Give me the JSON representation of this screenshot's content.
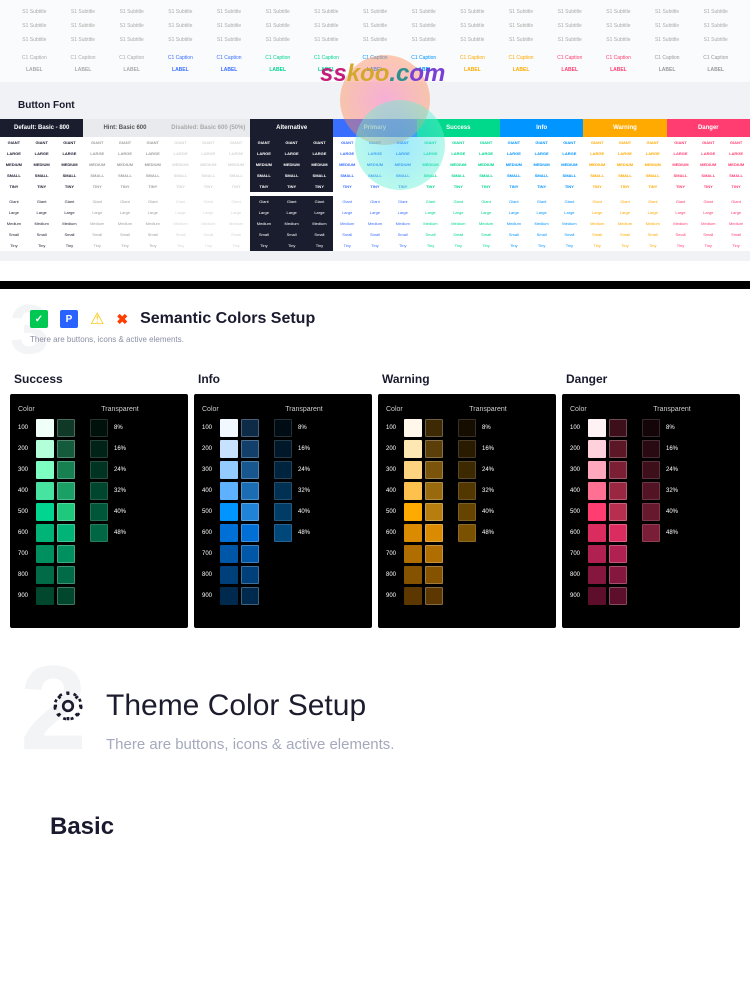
{
  "topRows": {
    "labels_row": [
      "S1 Subtitle",
      "S1 Subtitle",
      "S1 Subtitle",
      "S1 Subtitle",
      "S1 Subtitle",
      "S1 Subtitle",
      "S1 Subtitle",
      "S1 Subtitle",
      "S1 Subtitle",
      "S1 Subtitle",
      "S1 Subtitle",
      "S1 Subtitle",
      "S1 Subtitle",
      "S1 Subtitle",
      "S1 Subtitle"
    ],
    "caption_row": [
      "C1 Caption",
      "C1 Caption",
      "C1 Caption",
      "C1 Caption",
      "C1 Caption",
      "C1 Caption",
      "C1 Caption",
      "C1 Caption",
      "C1 Caption",
      "C1 Caption",
      "C1 Caption",
      "C1 Caption",
      "C1 Caption",
      "C1 Caption",
      "C1 Caption"
    ],
    "label_row": [
      "LABEL",
      "LABEL",
      "LABEL",
      "LABEL",
      "LABEL",
      "LABEL",
      "LABEL",
      "LABEL",
      "LABEL",
      "LABEL",
      "LABEL",
      "LABEL",
      "LABEL",
      "LABEL",
      "LABEL"
    ]
  },
  "topColors": [
    "#aaa",
    "#aaa",
    "#aaa",
    "#3a6eff",
    "#3a6eff",
    "#00d68f",
    "#00d68f",
    "#0095ff",
    "#0095ff",
    "#ffaa00",
    "#ffaa00",
    "#ff3d71",
    "#ff3d71",
    "#999",
    "#999"
  ],
  "buttonFont": {
    "title": "Button Font",
    "headers": [
      "Default: Basic - 800",
      "Hint: Basic 600",
      "Disabled: Basic 600 (50%)",
      "Alternative",
      "Primary",
      "Success",
      "Info",
      "Warning",
      "Danger"
    ],
    "sizes_upper": [
      "GIANT",
      "LARGE",
      "MEDIUM",
      "SMALL",
      "TINY"
    ],
    "sizes_title": [
      "Giant",
      "Large",
      "Medium",
      "Small",
      "Tiny"
    ],
    "groupColors": {
      "default": "#1a1a2e",
      "hint": "#a0a0a0",
      "disabled": "#d5d5d5",
      "alternative": "#ffffff",
      "primary": "#3a6eff",
      "success": "#00d68f",
      "info": "#0095ff",
      "warning": "#ffaa00",
      "danger": "#ff3d71"
    }
  },
  "semantic": {
    "title": "Semantic Colors Setup",
    "subtitle": "There are buttons, icons & active elements.",
    "bgNum": "3"
  },
  "palettes": [
    {
      "title": "Success",
      "colorHdr": "Color",
      "transHdr": "Transparent",
      "shades": [
        {
          "num": "100",
          "c": "#f0fff7",
          "o": "#103826"
        },
        {
          "num": "200",
          "c": "#b3ffd9",
          "o": "#135b3a"
        },
        {
          "num": "300",
          "c": "#7dffc2",
          "o": "#178050"
        },
        {
          "num": "400",
          "c": "#47e3a0",
          "o": "#1aa065"
        },
        {
          "num": "500",
          "c": "#00d68f",
          "o": "#1ec97e"
        },
        {
          "num": "600",
          "c": "#00b377",
          "o": "#00b377"
        },
        {
          "num": "700",
          "c": "#008f5e",
          "o": "#008f5e"
        },
        {
          "num": "800",
          "c": "#006b46",
          "o": "#006b46"
        },
        {
          "num": "900",
          "c": "#00472e",
          "o": "#00472e"
        }
      ],
      "trans": [
        {
          "p": "8%",
          "c": "rgba(0,214,143,0.08)"
        },
        {
          "p": "16%",
          "c": "rgba(0,214,143,0.16)"
        },
        {
          "p": "24%",
          "c": "rgba(0,214,143,0.24)"
        },
        {
          "p": "32%",
          "c": "rgba(0,214,143,0.32)"
        },
        {
          "p": "40%",
          "c": "rgba(0,214,143,0.40)"
        },
        {
          "p": "48%",
          "c": "rgba(0,214,143,0.48)"
        }
      ]
    },
    {
      "title": "Info",
      "colorHdr": "Color",
      "transHdr": "Transparent",
      "shades": [
        {
          "num": "100",
          "c": "#f2f8ff",
          "o": "#0d2a47"
        },
        {
          "num": "200",
          "c": "#c7e2ff",
          "o": "#12406b"
        },
        {
          "num": "300",
          "c": "#94cbff",
          "o": "#17568f"
        },
        {
          "num": "400",
          "c": "#5eb1ff",
          "o": "#1b6db3"
        },
        {
          "num": "500",
          "c": "#0095ff",
          "o": "#2083d7"
        },
        {
          "num": "600",
          "c": "#006fd6",
          "o": "#006fd6"
        },
        {
          "num": "700",
          "c": "#0057a8",
          "o": "#0057a8"
        },
        {
          "num": "800",
          "c": "#00407a",
          "o": "#00407a"
        },
        {
          "num": "900",
          "c": "#002a4d",
          "o": "#002a4d"
        }
      ],
      "trans": [
        {
          "p": "8%",
          "c": "rgba(0,149,255,0.08)"
        },
        {
          "p": "16%",
          "c": "rgba(0,149,255,0.16)"
        },
        {
          "p": "24%",
          "c": "rgba(0,149,255,0.24)"
        },
        {
          "p": "32%",
          "c": "rgba(0,149,255,0.32)"
        },
        {
          "p": "40%",
          "c": "rgba(0,149,255,0.40)"
        },
        {
          "p": "48%",
          "c": "rgba(0,149,255,0.48)"
        }
      ]
    },
    {
      "title": "Warning",
      "colorHdr": "Color",
      "transHdr": "Transparent",
      "shades": [
        {
          "num": "100",
          "c": "#fff8eb",
          "o": "#3d2a05"
        },
        {
          "num": "200",
          "c": "#ffe7b3",
          "o": "#5c3f08"
        },
        {
          "num": "300",
          "c": "#ffd480",
          "o": "#7a540a"
        },
        {
          "num": "400",
          "c": "#ffc14d",
          "o": "#99690d"
        },
        {
          "num": "500",
          "c": "#ffaa00",
          "o": "#b77e0f"
        },
        {
          "num": "600",
          "c": "#db8b00",
          "o": "#db8b00"
        },
        {
          "num": "700",
          "c": "#b06e00",
          "o": "#b06e00"
        },
        {
          "num": "800",
          "c": "#855200",
          "o": "#855200"
        },
        {
          "num": "900",
          "c": "#5c3700",
          "o": "#5c3700"
        }
      ],
      "trans": [
        {
          "p": "8%",
          "c": "rgba(255,170,0,0.08)"
        },
        {
          "p": "16%",
          "c": "rgba(255,170,0,0.16)"
        },
        {
          "p": "24%",
          "c": "rgba(255,170,0,0.24)"
        },
        {
          "p": "32%",
          "c": "rgba(255,170,0,0.32)"
        },
        {
          "p": "40%",
          "c": "rgba(255,170,0,0.40)"
        },
        {
          "p": "48%",
          "c": "rgba(255,170,0,0.48)"
        }
      ]
    },
    {
      "title": "Danger",
      "colorHdr": "Color",
      "transHdr": "Transparent",
      "shades": [
        {
          "num": "100",
          "c": "#fff2f5",
          "o": "#3d0f1a"
        },
        {
          "num": "200",
          "c": "#ffd1dc",
          "o": "#5c1727"
        },
        {
          "num": "300",
          "c": "#ffa8bd",
          "o": "#7a1f34"
        },
        {
          "num": "400",
          "c": "#ff7093",
          "o": "#992741"
        },
        {
          "num": "500",
          "c": "#ff3d71",
          "o": "#b72e4e"
        },
        {
          "num": "600",
          "c": "#db2c60",
          "o": "#db2c60"
        },
        {
          "num": "700",
          "c": "#b02050",
          "o": "#b02050"
        },
        {
          "num": "800",
          "c": "#85163d",
          "o": "#85163d"
        },
        {
          "num": "900",
          "c": "#5c0e2a",
          "o": "#5c0e2a"
        }
      ],
      "trans": [
        {
          "p": "8%",
          "c": "rgba(255,61,113,0.08)"
        },
        {
          "p": "16%",
          "c": "rgba(255,61,113,0.16)"
        },
        {
          "p": "24%",
          "c": "rgba(255,61,113,0.24)"
        },
        {
          "p": "32%",
          "c": "rgba(255,61,113,0.32)"
        },
        {
          "p": "40%",
          "c": "rgba(255,61,113,0.40)"
        },
        {
          "p": "48%",
          "c": "rgba(255,61,113,0.48)"
        }
      ]
    }
  ],
  "theme": {
    "bgNum": "2",
    "title": "Theme Color Setup",
    "subtitle": "There are buttons, icons & active elements."
  },
  "basic": {
    "title": "Basic"
  },
  "watermark": "sskoo.com"
}
